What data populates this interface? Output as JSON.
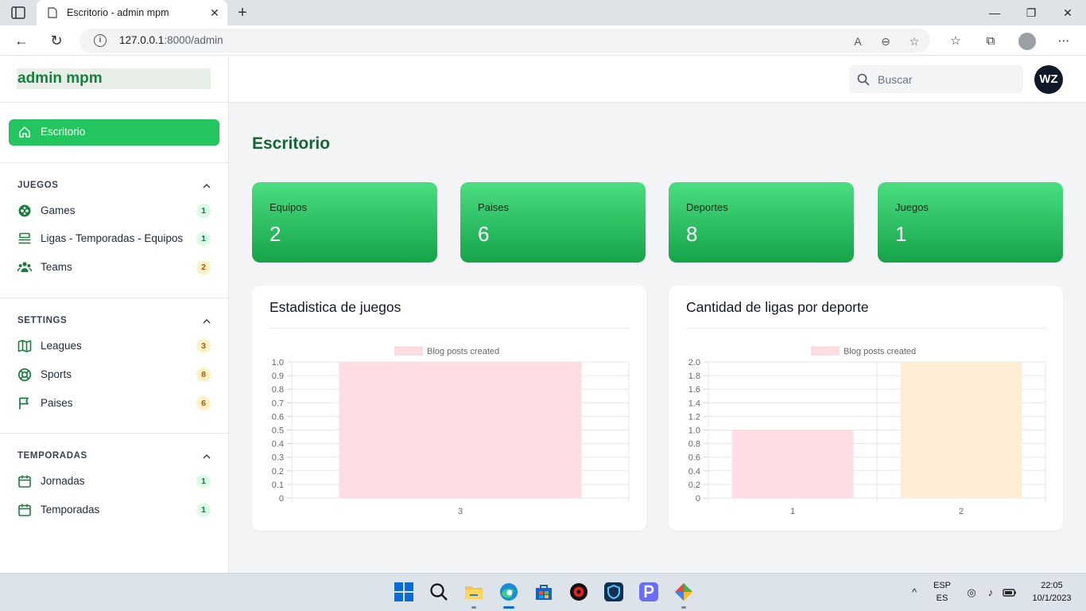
{
  "browser": {
    "tab_title": "Escritorio - admin mpm",
    "url_host": "127.0.0.1",
    "url_rest": ":8000/admin",
    "new_tab_glyph": "+",
    "close_glyph": "✕"
  },
  "sidebar": {
    "brand": "admin mpm",
    "active_item": {
      "label": "Escritorio",
      "icon": "home-icon"
    },
    "sections": [
      {
        "title": "JUEGOS",
        "items": [
          {
            "label": "Games",
            "badge": "1",
            "icon": "gamepad-icon"
          },
          {
            "label": "Ligas - Temporadas - Equipos",
            "badge": "1",
            "icon": "layers-icon"
          },
          {
            "label": "Teams",
            "badge": "2",
            "icon": "users-icon"
          }
        ]
      },
      {
        "title": "SETTINGS",
        "items": [
          {
            "label": "Leagues",
            "badge": "3",
            "icon": "map-icon"
          },
          {
            "label": "Sports",
            "badge": "8",
            "icon": "lifebuoy-icon"
          },
          {
            "label": "Paises",
            "badge": "6",
            "icon": "flag-icon"
          }
        ]
      },
      {
        "title": "TEMPORADAS",
        "items": [
          {
            "label": "Jornadas",
            "badge": "1",
            "icon": "calendar-icon"
          },
          {
            "label": "Temporadas",
            "badge": "1",
            "icon": "calendar-icon"
          }
        ]
      }
    ]
  },
  "header": {
    "search_placeholder": "Buscar",
    "avatar_initials": "WZ"
  },
  "main": {
    "title": "Escritorio",
    "stats": [
      {
        "label": "Equipos",
        "value": "2"
      },
      {
        "label": "Paises",
        "value": "6"
      },
      {
        "label": "Deportes",
        "value": "8"
      },
      {
        "label": "Juegos",
        "value": "1"
      }
    ],
    "cards": [
      {
        "title": "Estadistica de juegos"
      },
      {
        "title": "Cantidad de ligas por deporte"
      }
    ]
  },
  "colors": {
    "accent": "#22c55e",
    "brand_text": "#15803d",
    "bar_pink": "#ffdde3",
    "bar_orange": "#ffedd5"
  },
  "chart_data": [
    {
      "type": "bar",
      "title": "Estadistica de juegos",
      "legend": [
        "Blog posts created"
      ],
      "legend_position": "top",
      "categories": [
        "3"
      ],
      "series": [
        {
          "name": "Blog posts created",
          "values": [
            1
          ]
        }
      ],
      "bar_colors": [
        "#ffdde3"
      ],
      "ylim": [
        0,
        1.0
      ],
      "yticks": [
        "0",
        "0.1",
        "0.2",
        "0.3",
        "0.4",
        "0.5",
        "0.6",
        "0.7",
        "0.8",
        "0.9",
        "1.0"
      ],
      "grid": true
    },
    {
      "type": "bar",
      "title": "Cantidad de ligas por deporte",
      "legend": [
        "Blog posts created"
      ],
      "legend_position": "top",
      "categories": [
        "1",
        "2"
      ],
      "series": [
        {
          "name": "Blog posts created",
          "values": [
            1,
            2
          ]
        }
      ],
      "bar_colors": [
        "#ffdde3",
        "#ffedd5"
      ],
      "ylim": [
        0,
        2.0
      ],
      "yticks": [
        "0",
        "0.2",
        "0.4",
        "0.6",
        "0.8",
        "1.0",
        "1.2",
        "1.4",
        "1.6",
        "1.8",
        "2.0"
      ],
      "grid": true
    }
  ],
  "taskbar": {
    "lang_top": "ESP",
    "lang_bottom": "ES",
    "time": "22:05",
    "date": "10/1/2023",
    "apps": [
      "start-icon",
      "search-icon",
      "file-explorer-icon",
      "edge-icon",
      "store-icon",
      "app-red-icon",
      "app-shield-icon",
      "app-p-icon",
      "app-git-icon"
    ]
  }
}
